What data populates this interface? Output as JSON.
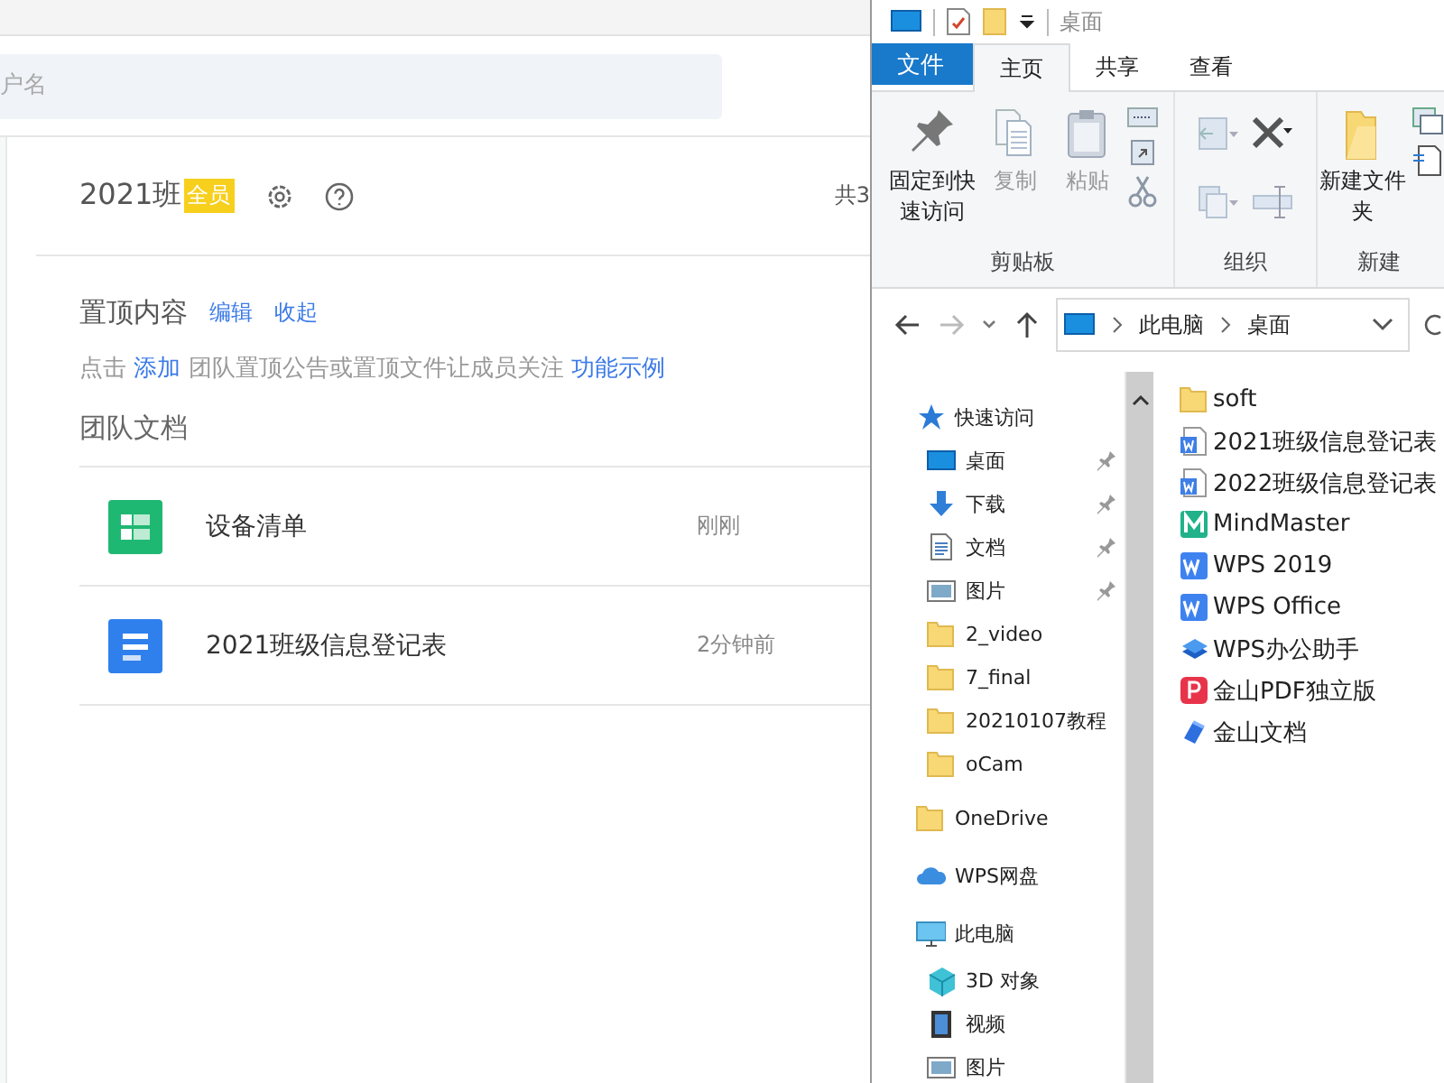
{
  "team_app": {
    "search": {
      "placeholder": "户名"
    },
    "team": {
      "name": "2021班",
      "badge": "全员",
      "count": "共3"
    },
    "pinned": {
      "title": "置顶内容",
      "actions": [
        "编辑",
        "收起"
      ],
      "hint": [
        {
          "kind": "text",
          "text": "点击"
        },
        {
          "kind": "link",
          "text": "添加"
        },
        {
          "kind": "text",
          "text": "团队置顶公告或置顶文件让成员关注"
        },
        {
          "kind": "link",
          "text": "功能示例"
        }
      ]
    },
    "docs": {
      "title": "团队文档",
      "rows": [
        {
          "kind": "sheet",
          "name": "设备清单",
          "time": "刚刚"
        },
        {
          "kind": "doc",
          "name": "2021班级信息登记表",
          "time": "2分钟前"
        }
      ]
    }
  },
  "explorer": {
    "window": {
      "title": "桌面"
    },
    "tabs": [
      {
        "label": "文件",
        "kind": "file",
        "selected": false
      },
      {
        "label": "主页",
        "kind": "tab",
        "selected": true
      },
      {
        "label": "共享",
        "kind": "tab",
        "selected": false
      },
      {
        "label": "查看",
        "kind": "tab",
        "selected": false
      }
    ],
    "ribbon": [
      {
        "label": "剪贴板",
        "buttons": [
          {
            "label": "固定到快速访问",
            "kind": "pin",
            "disabled": false
          },
          {
            "label": "复制",
            "kind": "copy",
            "disabled": true
          },
          {
            "label": "粘贴",
            "kind": "paste",
            "disabled": true
          }
        ]
      },
      {
        "label": "组织"
      },
      {
        "label": "新建",
        "buttons": [
          {
            "label": "新建文件夹",
            "kind": "folder",
            "disabled": false
          }
        ]
      }
    ],
    "address": {
      "path": [
        "此电脑",
        "桌面"
      ]
    },
    "nav": [
      {
        "label": "快速访问",
        "kind": "star",
        "children": [
          {
            "label": "桌面",
            "kind": "desktop",
            "pinned": true
          },
          {
            "label": "下载",
            "kind": "download",
            "pinned": true
          },
          {
            "label": "文档",
            "kind": "document",
            "pinned": true
          },
          {
            "label": "图片",
            "kind": "picture",
            "pinned": true
          },
          {
            "label": "2_video",
            "kind": "folder",
            "pinned": false
          },
          {
            "label": "7_final",
            "kind": "folder",
            "pinned": false
          },
          {
            "label": "20210107教程",
            "kind": "folder",
            "pinned": false
          },
          {
            "label": "oCam",
            "kind": "folder",
            "pinned": false
          }
        ]
      },
      {
        "label": "OneDrive",
        "kind": "folder"
      },
      {
        "label": "WPS网盘",
        "kind": "cloud"
      },
      {
        "label": "此电脑",
        "kind": "pc",
        "children": [
          {
            "label": "3D 对象",
            "kind": "cube",
            "pinned": false
          },
          {
            "label": "视频",
            "kind": "video",
            "pinned": false
          },
          {
            "label": "图片",
            "kind": "picture",
            "pinned": false
          }
        ]
      }
    ],
    "files": [
      {
        "name": "soft",
        "kind": "folder"
      },
      {
        "name": "2021班级信息登记表",
        "kind": "word"
      },
      {
        "name": "2022班级信息登记表",
        "kind": "word"
      },
      {
        "name": "MindMaster",
        "kind": "mindmaster"
      },
      {
        "name": "WPS 2019",
        "kind": "wps"
      },
      {
        "name": "WPS Office",
        "kind": "wps"
      },
      {
        "name": "WPS办公助手",
        "kind": "assistant"
      },
      {
        "name": "金山PDF独立版",
        "kind": "pdf"
      },
      {
        "name": "金山文档",
        "kind": "kdocs"
      }
    ]
  }
}
